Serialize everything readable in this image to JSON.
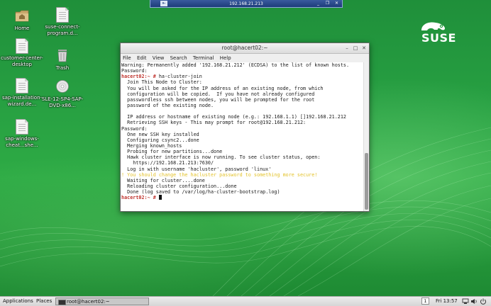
{
  "remote_bar": {
    "title": "192.168.21.213",
    "pin_icon": "pin-icon",
    "controls": [
      "_",
      "❐",
      "✕"
    ]
  },
  "desktop": {
    "brand": "SUSE",
    "icons": [
      {
        "label": "Home",
        "icon": "home-folder-icon"
      },
      {
        "label": "suse-connect-program.d...",
        "icon": "document-icon"
      },
      {
        "label": "customer-center-desktop",
        "icon": "document-icon"
      },
      {
        "label": "Trash",
        "icon": "trash-icon"
      },
      {
        "label": "sap-installation-wizard.de...",
        "icon": "document-icon"
      },
      {
        "label": "SLE-12-SP4-SAP-DVD-x86...",
        "icon": "disc-icon"
      },
      {
        "label": "sap-windows-cheat...she...",
        "icon": "document-icon"
      }
    ]
  },
  "terminal": {
    "title": "root@hacert02:~",
    "menu": [
      "File",
      "Edit",
      "View",
      "Search",
      "Terminal",
      "Help"
    ],
    "lines": [
      {
        "t": "Warning: Permanently added '192.168.21.212' (ECDSA) to the list of known hosts."
      },
      {
        "t": "Password:"
      },
      {
        "p": "hacert02:~ # ",
        "t": "ha-cluster-join"
      },
      {
        "t": "  Join This Node to Cluster:"
      },
      {
        "t": "  You will be asked for the IP address of an existing node, from which"
      },
      {
        "t": "  configuration will be copied.  If you have not already configured"
      },
      {
        "t": "  passwordless ssh between nodes, you will be prompted for the root"
      },
      {
        "t": "  password of the existing node."
      },
      {
        "t": ""
      },
      {
        "t": "  IP address or hostname of existing node (e.g.: 192.168.1.1) []192.168.21.212"
      },
      {
        "t": "  Retrieving SSH keys - This may prompt for root@192.168.21.212:"
      },
      {
        "t": "Password:"
      },
      {
        "t": "  One new SSH key installed"
      },
      {
        "t": "  Configuring csync2...done"
      },
      {
        "t": "  Merging known_hosts"
      },
      {
        "t": "  Probing for new partitions...done"
      },
      {
        "t": "  Hawk cluster interface is now running. To see cluster status, open:"
      },
      {
        "t": "    https://192.168.21.213:7630/"
      },
      {
        "t": "  Log in with username 'hacluster', password 'linux'"
      },
      {
        "w": "! You should change the hacluster password to something more secure!"
      },
      {
        "t": "  Waiting for cluster....done"
      },
      {
        "t": "  Reloading cluster configuration...done"
      },
      {
        "t": "  Done (log saved to /var/log/ha-cluster-bootstrap.log)"
      },
      {
        "p": "hacert02:~ # ",
        "t": "",
        "cursor": true
      }
    ]
  },
  "panel": {
    "applications": "Applications",
    "places": "Places",
    "task": "root@hacert02:~",
    "workspace": "1",
    "clock": "Fri 13:57",
    "tray_icons": [
      "network-icon",
      "volume-icon",
      "power-icon"
    ]
  }
}
